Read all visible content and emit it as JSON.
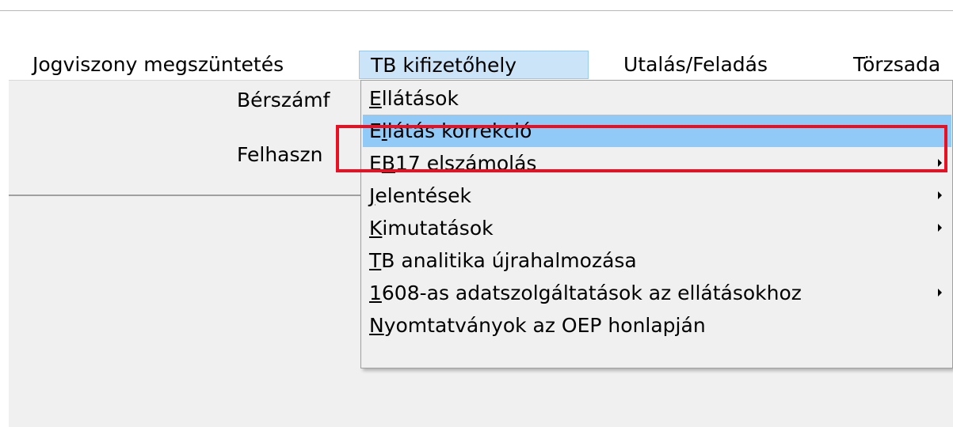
{
  "menubar": {
    "items": [
      {
        "label": "Jogviszony megszüntetés",
        "active": false
      },
      {
        "label": "TB kifizetőhely",
        "active": true
      },
      {
        "label": "Utalás/Feladás",
        "active": false
      },
      {
        "label": "Törzsada",
        "active": false
      }
    ]
  },
  "form": {
    "label1": "Bérszámf",
    "label2": "Felhaszn"
  },
  "dropdown": {
    "items": [
      {
        "mnemonic": "E",
        "rest": "llátások",
        "has_submenu": false,
        "highlighted": false
      },
      {
        "pre": "E",
        "mnemonic": "l",
        "rest": "látás korrekció",
        "has_submenu": false,
        "highlighted": true
      },
      {
        "pre": "E",
        "mnemonic": "B",
        "rest": "17 elszámolás",
        "has_submenu": true,
        "highlighted": false
      },
      {
        "mnemonic": "J",
        "rest": "elentések",
        "has_submenu": true,
        "highlighted": false
      },
      {
        "mnemonic": "K",
        "rest": "imutatások",
        "has_submenu": true,
        "highlighted": false
      },
      {
        "mnemonic": "T",
        "rest": "B analitika újrahalmozása",
        "has_submenu": false,
        "highlighted": false
      },
      {
        "mnemonic": "1",
        "rest": "608-as adatszolgáltatások az ellátásokhoz",
        "has_submenu": true,
        "highlighted": false
      },
      {
        "mnemonic": "N",
        "rest": "yomtatványok az OEP honlapján",
        "has_submenu": false,
        "highlighted": false
      }
    ]
  },
  "colors": {
    "highlight": "#91c9f7",
    "annotation_box": "#e81123",
    "active_menu": "#cce4f7"
  }
}
